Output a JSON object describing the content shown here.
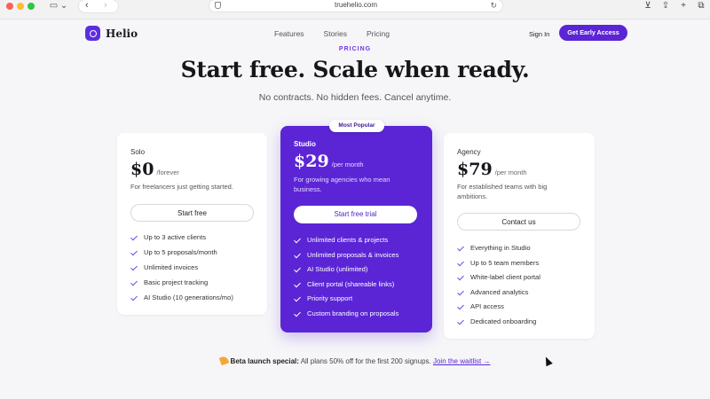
{
  "browser": {
    "url": "truehelio.com"
  },
  "header": {
    "brand": "Helio",
    "nav": [
      "Features",
      "Stories",
      "Pricing"
    ],
    "sign_in": "Sign In",
    "cta": "Get Early Access"
  },
  "hero": {
    "eyebrow": "PRICING",
    "title": "Start free. Scale when ready.",
    "subtitle": "No contracts. No hidden fees. Cancel anytime."
  },
  "plans": [
    {
      "name": "Solo",
      "price": "$0",
      "period": "/forever",
      "description": "For freelancers just getting started.",
      "button": "Start free",
      "features": [
        "Up to 3 active clients",
        "Up to 5 proposals/month",
        "Unlimited invoices",
        "Basic project tracking",
        "AI Studio (10 generations/mo)"
      ]
    },
    {
      "badge": "Most Popular",
      "name": "Studio",
      "price": "$29",
      "period": "/per month",
      "description": "For growing agencies who mean business.",
      "button": "Start free trial",
      "features": [
        "Unlimited clients & projects",
        "Unlimited proposals & invoices",
        "AI Studio (unlimited)",
        "Client portal (shareable links)",
        "Priority support",
        "Custom branding on proposals"
      ]
    },
    {
      "name": "Agency",
      "price": "$79",
      "period": "/per month",
      "description": "For established teams with big ambitions.",
      "button": "Contact us",
      "features": [
        "Everything in Studio",
        "Up to 5 team members",
        "White-label client portal",
        "Advanced analytics",
        "API access",
        "Dedicated onboarding"
      ]
    }
  ],
  "promo": {
    "label": "Beta launch special:",
    "text": " All plans 50% off for the first 200 signups. ",
    "link": "Join the waitlist →"
  },
  "colors": {
    "accent": "#5b25d6",
    "background": "#f6f6f8"
  }
}
